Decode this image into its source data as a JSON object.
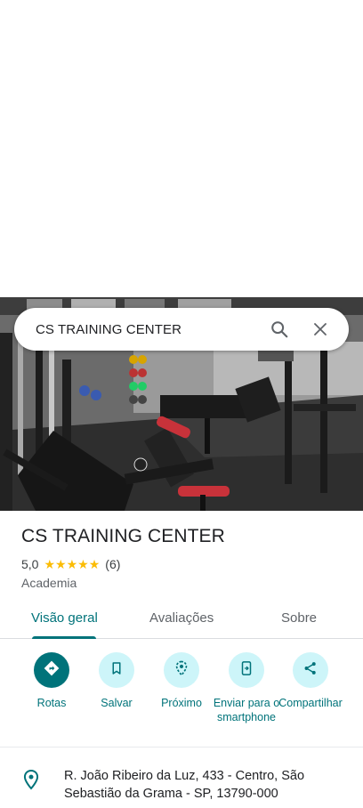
{
  "search": {
    "query": "CS TRAINING CENTER"
  },
  "place": {
    "name": "CS TRAINING CENTER",
    "rating": "5,0",
    "stars": 5,
    "review_count": "(6)",
    "category": "Academia"
  },
  "tabs": [
    {
      "label": "Visão geral",
      "active": true
    },
    {
      "label": "Avaliações",
      "active": false
    },
    {
      "label": "Sobre",
      "active": false
    }
  ],
  "actions": [
    {
      "label": "Rotas",
      "icon": "directions-icon"
    },
    {
      "label": "Salvar",
      "icon": "bookmark-icon"
    },
    {
      "label": "Próximo",
      "icon": "nearby-icon"
    },
    {
      "label": "Enviar para o smartphone",
      "icon": "send-to-phone-icon"
    },
    {
      "label": "Compartilhar",
      "icon": "share-icon"
    }
  ],
  "address": {
    "text": "R. João Ribeiro da Luz, 433 - Centro, São Sebastião da Grama - SP, 13790-000"
  },
  "colors": {
    "accent": "#00737a",
    "accent_light": "#cdf5f9",
    "star": "#fbbc04"
  }
}
